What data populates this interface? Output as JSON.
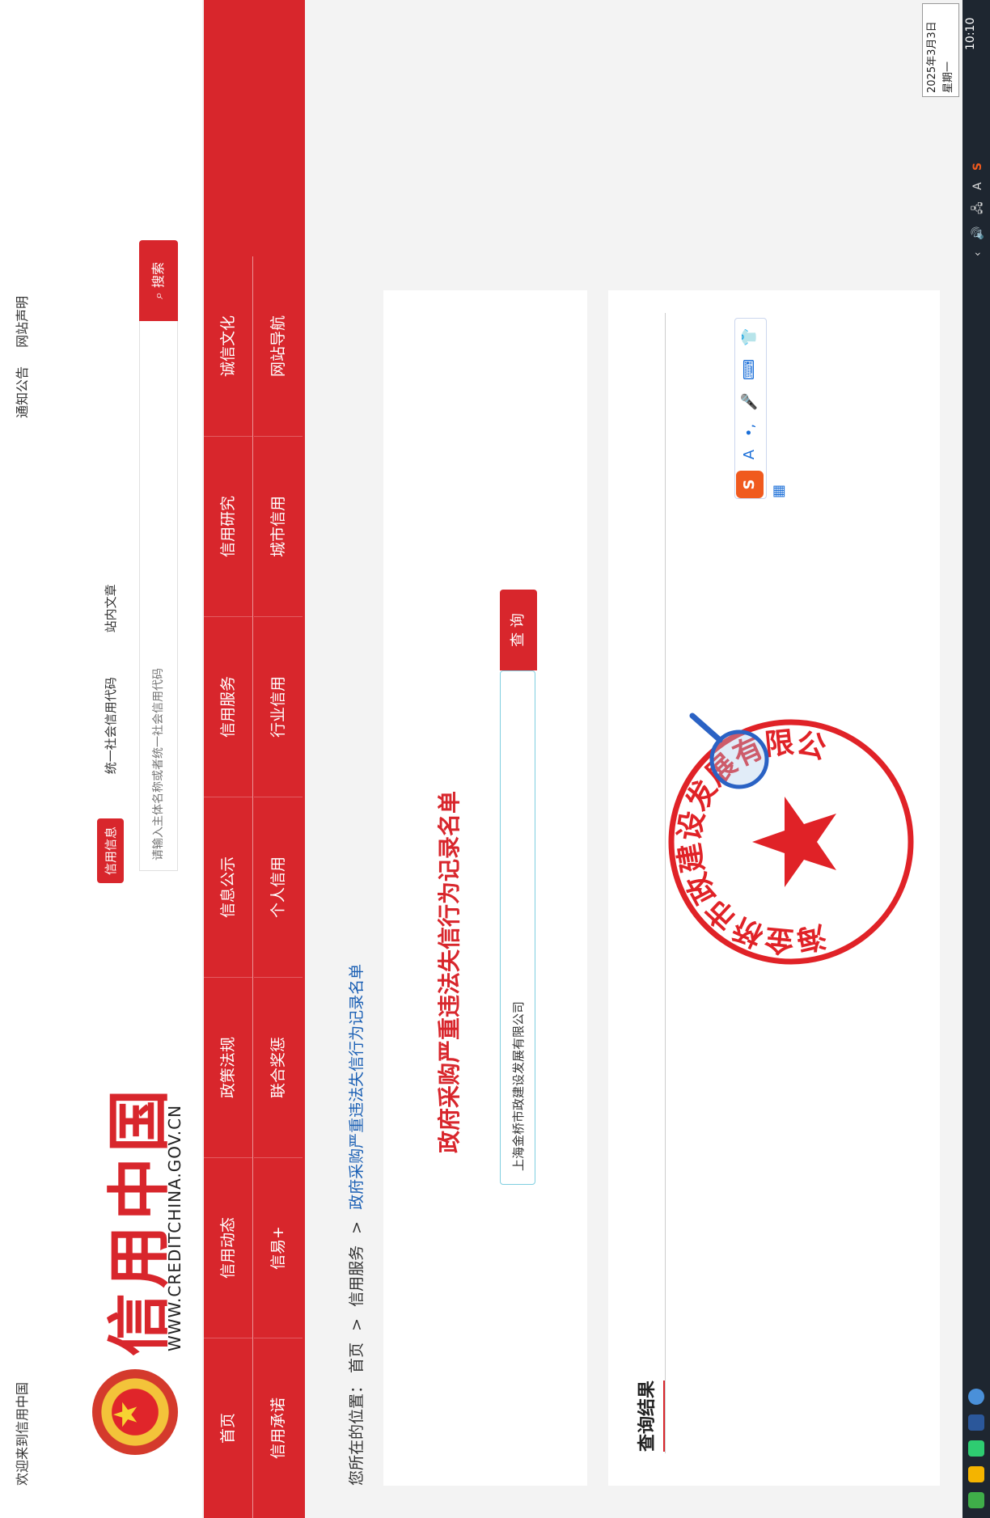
{
  "topbar": {
    "welcome": "欢迎来到信用中国",
    "notice": "通知公告",
    "statement": "网站声明"
  },
  "header": {
    "logo_cn": "信用中国",
    "logo_en": "WWW.CREDITCHINA.GOV.CN",
    "tabs": [
      "信用信息",
      "统一社会信用代码",
      "站内文章"
    ],
    "search_placeholder": "请输入主体名称或者统一社会信用代码",
    "search_button": "搜索"
  },
  "nav": {
    "row1": [
      "首页",
      "信用动态",
      "政策法规",
      "信息公示",
      "信用服务",
      "信用研究",
      "诚信文化"
    ],
    "row2": [
      "信用承诺",
      "信易+",
      "联合奖惩",
      "个人信用",
      "行业信用",
      "城市信用",
      "网站导航"
    ]
  },
  "breadcrumb": {
    "prefix": "您所在的位置：",
    "items": [
      "首页",
      "信用服务",
      "政府采购严重违法失信行为记录名单"
    ],
    "separator": ">"
  },
  "query": {
    "title": "政府采购严重违法失信行为记录名单",
    "input_value": "上海金桥市政建设发展有限公司",
    "button": "查 询"
  },
  "results": {
    "title": "查询结果"
  },
  "stamp": {
    "text": "上海金桥市政建设发展有限公司"
  },
  "ime": {
    "items": [
      "A",
      "•,",
      "🎤",
      "⌨",
      "👕",
      "▦"
    ]
  },
  "taskbar": {
    "time": "10:10",
    "date": "2025年3月3日",
    "weekday": "星期一",
    "tray": [
      "A"
    ]
  },
  "colors": {
    "brand_red": "#d8262c",
    "link_blue": "#1a5fb4",
    "taskbar": "#1e2630"
  }
}
